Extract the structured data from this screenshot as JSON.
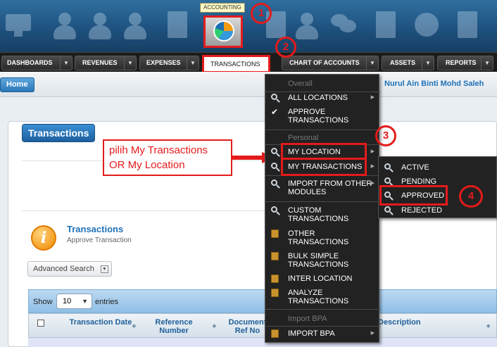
{
  "top_bar": {
    "accounting_tooltip": "ACCOUNTING",
    "accounting_icon": "pie-chart-icon"
  },
  "steps": [
    "1",
    "2",
    "3",
    "4"
  ],
  "menu_bar": {
    "tabs": [
      "DASHBOARDS",
      "REVENUES",
      "EXPENSES",
      "TRANSACTIONS",
      "CHART OF ACCOUNTS",
      "ASSETS",
      "REPORTS"
    ]
  },
  "home": {
    "button": "Home",
    "user_name": "Nurul Ain Binti Mohd Saleh"
  },
  "panel": {
    "title": "Transactions",
    "page_title": "Transactions",
    "page_subtitle": "Approve Transaction",
    "advanced_search": "Advanced Search"
  },
  "table": {
    "show_label": "Show",
    "show_value": "10",
    "entries_label": "entries",
    "columns": [
      "Transaction Date",
      "Reference Number",
      "Document Ref No",
      "Description"
    ]
  },
  "dropdown": {
    "header_overall": "Overall",
    "all_locations": "ALL LOCATIONS",
    "approve_transactions": "APPROVE TRANSACTIONS",
    "header_personal": "Personal",
    "my_location": "MY LOCATION",
    "my_transactions": "MY TRANSACTIONS",
    "import_other_modules": "IMPORT FROM OTHER MODULES",
    "custom_transactions": "CUSTOM TRANSACTIONS",
    "other_transactions": "OTHER TRANSACTIONS",
    "bulk_simple_transactions": "BULK SIMPLE TRANSACTIONS",
    "inter_location": "INTER LOCATION",
    "analyze_transactions": "ANALYZE TRANSACTIONS",
    "header_import_bpa": "Import BPA",
    "import_bpa": "IMPORT BPA"
  },
  "submenu": {
    "items": [
      "ACTIVE",
      "PENDING",
      "APPROVED",
      "REJECTED"
    ]
  },
  "annotation": {
    "line1": "pilih My Transactions",
    "line2": "OR My Location"
  },
  "colors": {
    "highlight_red": "#e41b1b",
    "brand_blue": "#1f72b8",
    "menu_dark": "#222222"
  }
}
